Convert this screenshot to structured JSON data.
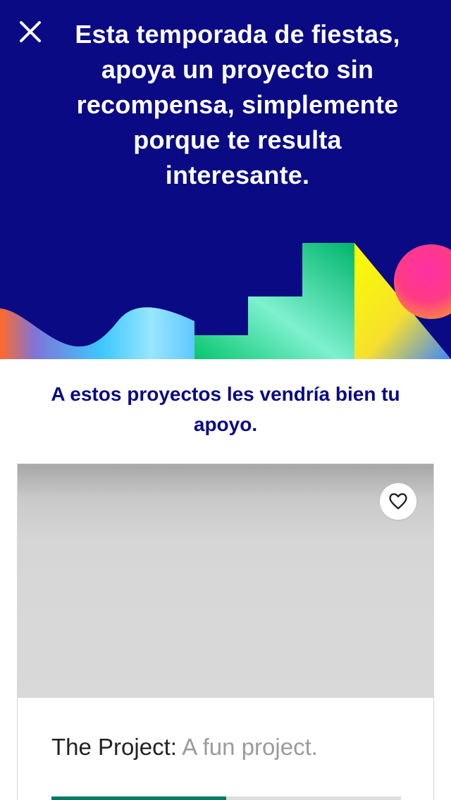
{
  "hero": {
    "background_color": "#0a0a85",
    "close_icon": "close-icon",
    "headline": "Esta temporada de fiestas, apoya un proyecto sin recompensa, simplemente porque te resulta interesante."
  },
  "section": {
    "subheading": "A estos proyectos les vendría bien tu apoyo."
  },
  "project": {
    "favorite_icon": "heart-outline-icon",
    "name": "The Project:",
    "blurb": "A fun project.",
    "funding_progress_percent": 50,
    "progress_color": "#057a62"
  }
}
